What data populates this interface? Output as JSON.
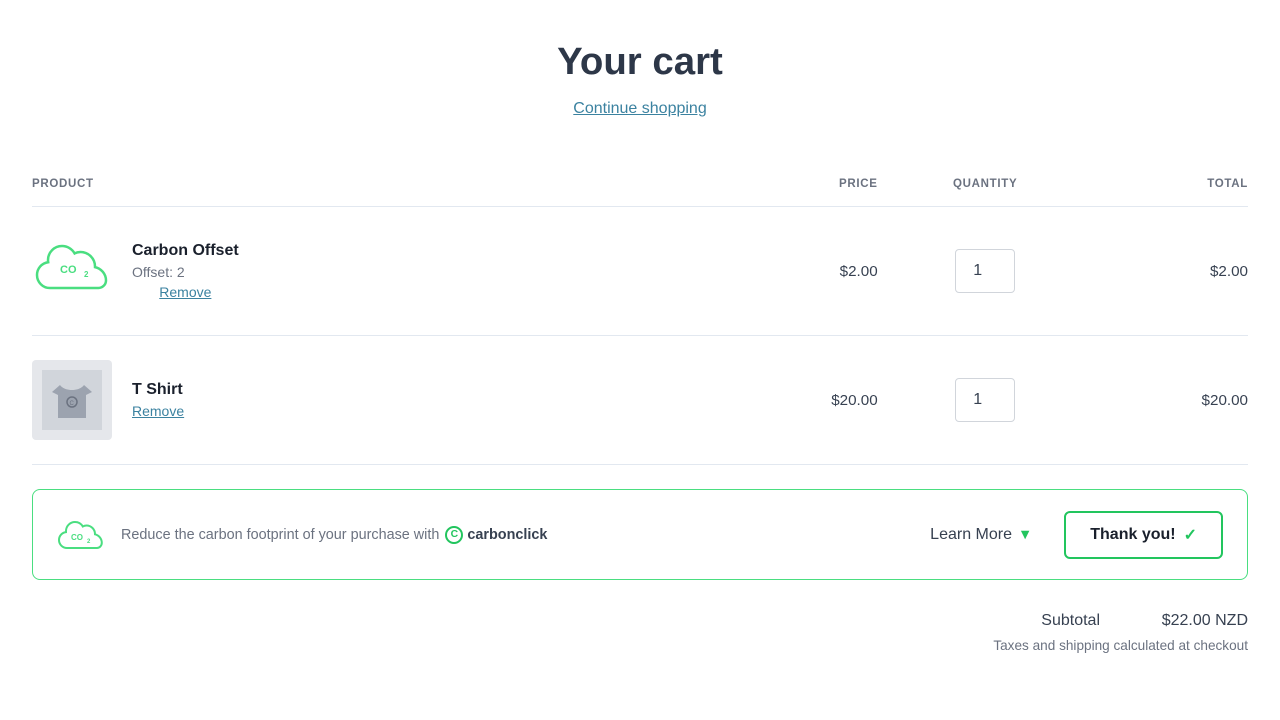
{
  "page": {
    "title": "Your cart"
  },
  "continue_shopping": {
    "label": "Continue shopping"
  },
  "table": {
    "headers": {
      "product": "PRODUCT",
      "price": "PRICE",
      "quantity": "QUANTITY",
      "total": "TOTAL"
    },
    "rows": [
      {
        "id": "carbon-offset",
        "name": "Carbon Offset",
        "meta": "Offset: 2",
        "remove_label": "Remove",
        "price": "$2.00",
        "quantity": 1,
        "total": "$2.00",
        "image_type": "co2"
      },
      {
        "id": "tshirt",
        "name": "T Shirt",
        "meta": "",
        "remove_label": "Remove",
        "price": "$20.00",
        "quantity": 1,
        "total": "$20.00",
        "image_type": "tshirt"
      }
    ]
  },
  "carbon_banner": {
    "text_before": "Reduce the carbon footprint of your purchase with",
    "brand_name": "carbonclick",
    "learn_more_label": "Learn More",
    "thank_you_label": "Thank you!"
  },
  "summary": {
    "subtotal_label": "Subtotal",
    "subtotal_value": "$22.00 NZD",
    "tax_note": "Taxes and shipping calculated at checkout"
  }
}
